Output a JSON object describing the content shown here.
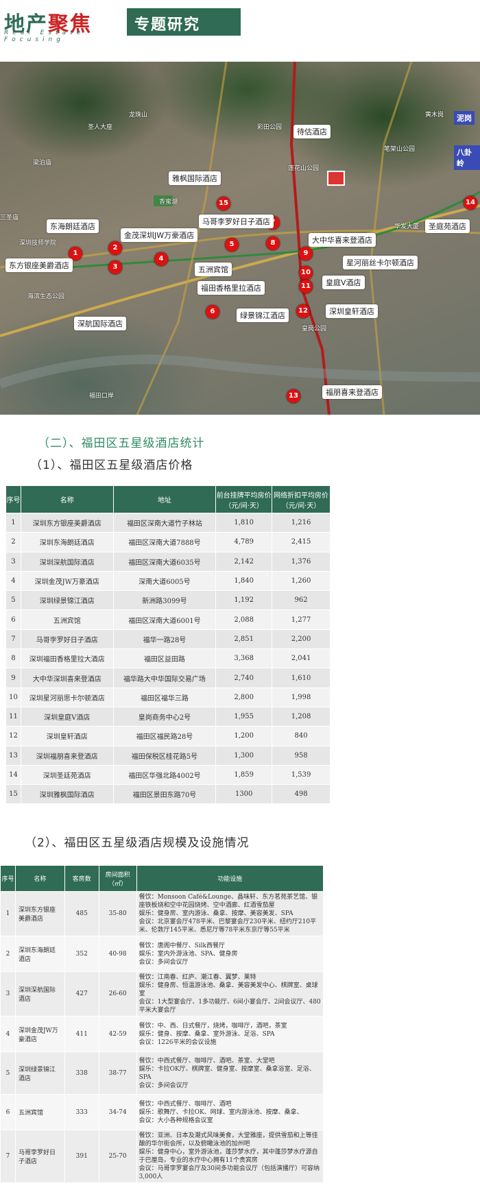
{
  "header": {
    "logo_main_a": "地产",
    "logo_main_b": "聚焦",
    "logo_sub": "Real Estate Focusing",
    "title": "专题研究"
  },
  "map": {
    "hotels": [
      {
        "n": "1",
        "label": "东方银座美爵酒店"
      },
      {
        "n": "2",
        "label": "东海朗廷酒店"
      },
      {
        "n": "3",
        "label": "深航国际酒店"
      },
      {
        "n": "4",
        "label": "金茂深圳JW万豪酒店"
      },
      {
        "n": "5",
        "label": "五洲宾馆"
      },
      {
        "n": "6",
        "label": "绿景锦江酒店"
      },
      {
        "n": "7",
        "label": "马哥李罗好日子酒店"
      },
      {
        "n": "8",
        "label": "福田香格里拉酒店"
      },
      {
        "n": "9",
        "label": "大中华喜来登酒店"
      },
      {
        "n": "10",
        "label": "星河丽丝卡尔顿酒店"
      },
      {
        "n": "11",
        "label": "皇庭V酒店"
      },
      {
        "n": "12",
        "label": "深圳皇轩酒店"
      },
      {
        "n": "13",
        "label": "福朋喜来登酒店"
      },
      {
        "n": "14",
        "label": "圣庭苑酒店"
      },
      {
        "n": "15",
        "label": "雅枫国际酒店"
      }
    ],
    "planned": "待估酒店",
    "places": [
      "龙珠山",
      "圣人大座",
      "梁泊庙",
      "香蜜湖",
      "深圳技师学院",
      "海滨生态公园",
      "笔架山公园",
      "莲花山公园",
      "彩田公园",
      "皇岗公园",
      "华发大厦",
      "黄木岗",
      "八卦岭",
      "泥岗",
      "三圣庙",
      "福田口岸"
    ],
    "badges": [
      "泥岗",
      "八卦岭"
    ]
  },
  "section": {
    "title": "（二）、福田区五星级酒店统计",
    "sub1": "（1）、福田区五星级酒店价格",
    "sub2": "（2）、福田区五星级酒店规模及设施情况"
  },
  "price_table": {
    "headers": [
      "序号",
      "名称",
      "地址",
      "前台挂牌平均房价（元/间·天）",
      "网络折扣平均房价（元/间·天）"
    ],
    "rows": [
      [
        "1",
        "深圳东方银座美爵酒店",
        "福田区深南大道竹子林站",
        "1,810",
        "1,216"
      ],
      [
        "2",
        "深圳东海朗廷酒店",
        "福田区深南大道7888号",
        "4,789",
        "2,415"
      ],
      [
        "3",
        "深圳深航国际酒店",
        "福田区深南大道6035号",
        "2,142",
        "1,376"
      ],
      [
        "4",
        "深圳金茂JW万豪酒店",
        "深南大道6005号",
        "1,840",
        "1,260"
      ],
      [
        "5",
        "深圳绿景锦江酒店",
        "新洲路3099号",
        "1,192",
        "962"
      ],
      [
        "6",
        "五洲宾馆",
        "福田区深南大道6001号",
        "2,088",
        "1,277"
      ],
      [
        "7",
        "马哥孛罗好日子酒店",
        "福华一路28号",
        "2,851",
        "2,200"
      ],
      [
        "8",
        "深圳福田香格里拉大酒店",
        "福田区益田路",
        "3,368",
        "2,041"
      ],
      [
        "9",
        "大中华深圳喜来登酒店",
        "福华路大中华国际交易广场",
        "2,740",
        "1,610"
      ],
      [
        "10",
        "深圳星河丽思卡尔顿酒店",
        "福田区福华三路",
        "2,800",
        "1,998"
      ],
      [
        "11",
        "深圳皇庭V酒店",
        "皇岗商务中心2号",
        "1,955",
        "1,208"
      ],
      [
        "12",
        "深圳皇轩酒店",
        "福田区福民路28号",
        "1,200",
        "840"
      ],
      [
        "13",
        "深圳福朋喜来登酒店",
        "福田保税区桂花路5号",
        "1,300",
        "958"
      ],
      [
        "14",
        "深圳圣廷苑酒店",
        "福田区华强北路4002号",
        "1,859",
        "1,539"
      ],
      [
        "15",
        "深圳雅枫国际酒店",
        "福田区景田东路70号",
        "1300",
        "498"
      ]
    ]
  },
  "facility_table": {
    "headers": [
      "序号",
      "名称",
      "客房数",
      "房间面积（㎡）",
      "功能设施"
    ],
    "rows": [
      [
        "1",
        "深圳东方银座美爵酒店",
        "485",
        "35-80",
        "餐饮：Monsoon Café&Lounge、晶味轩、东方茗苑茶艺馆、银座铁板烧和空中花园烧烤、空中酒廊、红酒雪茄屋\n娱乐：健身房、室内游泳、桑拿、按摩、美容美发、SPA\n会议：北京宴会厅478平米、巴黎宴会厅230平米、纽约厅210平米、伦敦厅145平米、悉尼厅等78平米东京厅等55平米"
      ],
      [
        "2",
        "深圳东海朗廷酒店",
        "352",
        "40-98",
        "餐饮：唐阁中餐厅、Silk西餐厅\n娱乐：室内外游泳池、SPA、健身房\n会议：多间会议厅"
      ],
      [
        "3",
        "深圳深航国际酒店",
        "427",
        "26-60",
        "餐饮：江南春、红庐、潮江春、翼梦、莱特\n娱乐：健身房、恒温游泳池、桑拿、美容美发中心、棋牌室、桌球室\n会议：1大型宴会厅、1多功能厅、6间小宴会厅、2间会议厅、480平米大宴会厅"
      ],
      [
        "4",
        "深圳金茂JW万豪酒店",
        "411",
        "42-59",
        "餐饮：中、西、日式餐厅，烧烤，咖啡厅，酒吧，茶室\n娱乐：健身、按摩、桑拿、室外游泳、足浴、SPA\n会议：1226平米的会议设施"
      ],
      [
        "5",
        "深圳绿景锦江酒店",
        "338",
        "38-77",
        "餐饮：中西式餐厅、咖啡厅、酒吧、茶室、大堂吧\n娱乐：卡拉OK厅、棋牌室、健身室、按摩室、桑拿浴室、足浴、SPA\n会议：多间会议厅"
      ],
      [
        "6",
        "五洲宾馆",
        "333",
        "34-74",
        "餐饮：中西式餐厅、咖啡厅、酒吧\n娱乐：歌舞厅、卡拉OK、网球、室内游泳池、按摩、桑拿、\n会议：大小各种规格会议室"
      ],
      [
        "7",
        "马哥孛罗好日子酒店",
        "391",
        "25-70",
        "餐饮：亚洲、日本及潮式风味美食，大堂雅座，提供雪茄和上等佳酿的华尔街会所，以及俯瞰泳池的加州吧\n娱乐：健身中心，室外游泳池，蓬莎梦水疗，其中蓬莎梦水疗源自于巴厘岛，专业的水疗中心拥有11个贵宾房\n会议：马哥孛罗宴会厅及30间多功能会议厅（包括演播厅）可容纳3,000人"
      ]
    ]
  }
}
